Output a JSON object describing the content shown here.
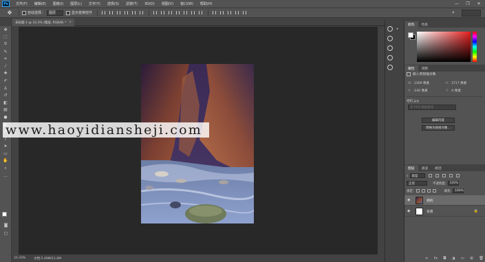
{
  "app": {
    "logo": "Ps"
  },
  "menubar": {
    "items": [
      "文件(F)",
      "编辑(E)",
      "图像(I)",
      "图层(L)",
      "文字(Y)",
      "选择(S)",
      "滤镜(T)",
      "3D(D)",
      "视图(V)",
      "窗口(W)",
      "帮助(H)"
    ],
    "min": "—",
    "max": "❐",
    "close": "✕"
  },
  "optionsbar": {
    "auto_select_label": "自动选择：",
    "auto_select_value": "图层",
    "show_transform_label": "显示变换控件",
    "move_icon": "✥"
  },
  "document": {
    "tab_label": "未标题-1 @ 33.3% (图层, RGB/8) *",
    "close": "×",
    "zoom": "33.33%",
    "doc_info": "文档:5.49M/11.0M"
  },
  "watermark": {
    "text": "www.haoyidiansheji.com"
  },
  "panels": {
    "color_tabs": [
      "颜色",
      "色板"
    ],
    "properties_tabs": [
      "属性",
      "调整"
    ],
    "properties_title": "嵌入的智能对象",
    "w_label": "W:",
    "w_value": "2309 像素",
    "h_label": "H:",
    "h_value": "3717 像素",
    "x_label": "X:",
    "x_value": "-240 像素",
    "y_label": "Y:",
    "y_value": "-4 像素",
    "source_label": "相机.jpg",
    "input_placeholder": "无 PSD 图层复合",
    "edit_button": "编辑内容",
    "convert_button": "转换为链接对象...",
    "layers_tabs": [
      "图层",
      "通道",
      "路径"
    ],
    "kind_label": "类型",
    "blend_mode": "正常",
    "opacity_label": "不透明度:",
    "opacity_value": "100%",
    "lock_label": "锁定:",
    "fill_label": "填充:",
    "fill_value": "100%",
    "layers": [
      {
        "name": "相机",
        "selected": true
      },
      {
        "name": "背景",
        "selected": false
      }
    ]
  },
  "colors": {
    "accent": "#31a8ff",
    "foreground": "#ffffff",
    "background": "#000000"
  }
}
